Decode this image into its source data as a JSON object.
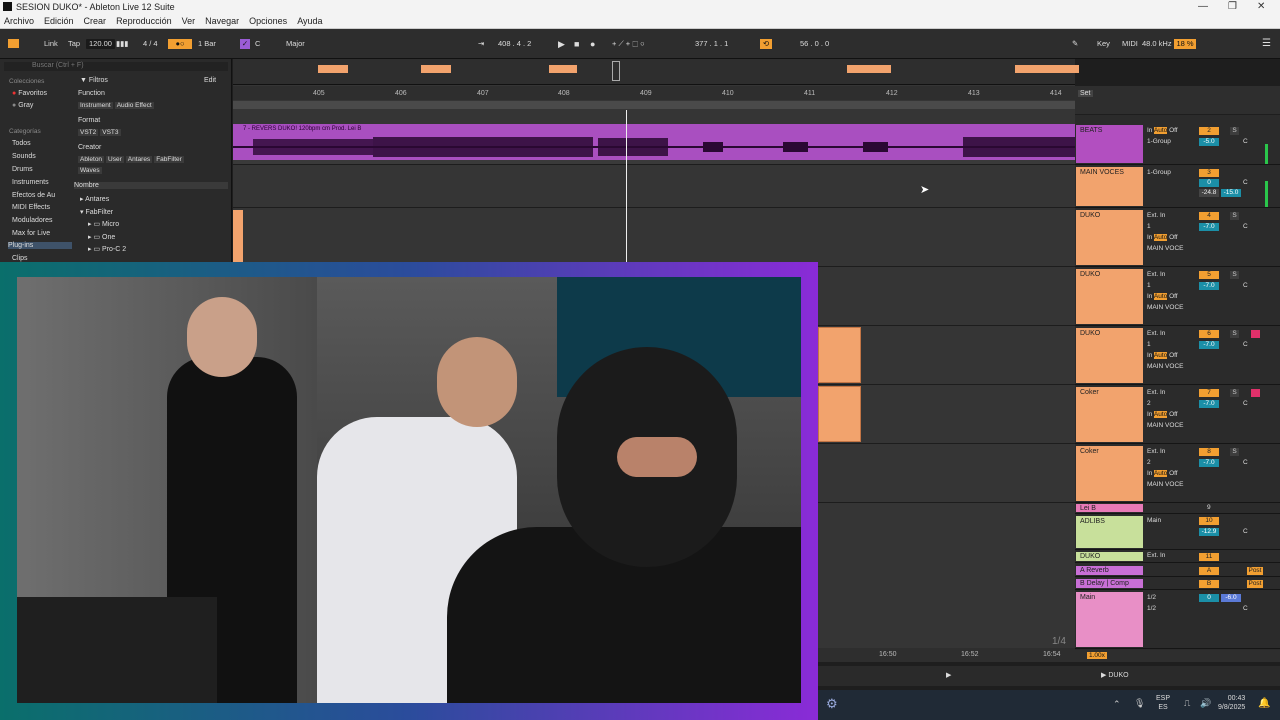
{
  "window": {
    "title": "SESION DUKO* - Ableton Live 12 Suite"
  },
  "menu": [
    "Archivo",
    "Edición",
    "Crear",
    "Reproducción",
    "Ver",
    "Navegar",
    "Opciones",
    "Ayuda"
  ],
  "transport": {
    "link": "Link",
    "tap": "Tap",
    "tempo": "120.00",
    "sig": "4 / 4",
    "quant": "1 Bar",
    "key": "C",
    "scale": "Major",
    "position": "408 . 4 . 2",
    "loop_start": "377 . 1 . 1",
    "loop_len": "56 . 0 . 0",
    "key_label": "Key",
    "midi_label": "MIDI",
    "sample_rate": "48.0 kHz",
    "cpu": "18 %"
  },
  "browser": {
    "search_placeholder": "Buscar (Ctrl + F)",
    "collections_label": "Colecciones",
    "favoritos": "Favoritos",
    "gray": "Gray",
    "categories_label": "Categorías",
    "categories": [
      "Todos",
      "Sounds",
      "Drums",
      "Instruments",
      "Efectos de Au",
      "MIDI Effects",
      "Moduladores",
      "Max for Live",
      "Plug-ins",
      "Clips"
    ],
    "filters_label": "Filtros",
    "edit": "Edit",
    "function": "Function",
    "format": "Format",
    "creator": "Creator",
    "function_tags": [
      "Instrument",
      "Audio Effect"
    ],
    "format_tags": [
      "VST2",
      "VST3"
    ],
    "creator_tags": [
      "Ableton",
      "User",
      "Antares",
      "FabFilter",
      "Waves"
    ],
    "name_header": "Nombre",
    "tree": [
      "Antares",
      "FabFilter",
      "Micro",
      "One",
      "Pro-C 2"
    ]
  },
  "ruler": [
    "405",
    "406",
    "407",
    "408",
    "409",
    "410",
    "411",
    "412",
    "413",
    "414"
  ],
  "clip_label": "7 - REVERS DUKO! 120bpm cm Prod. Lei B",
  "set_label": "Set",
  "fraction": "1/4",
  "times": [
    "16:50",
    "16:52",
    "16:54"
  ],
  "zoom": "1.00x",
  "bottom_track": "DUKO",
  "mixer": {
    "tracks": [
      {
        "name": "BEATS",
        "input": "In Auto Off",
        "route": "1-Group",
        "num": "2",
        "vol": "-5.0",
        "pan": "C",
        "color": "#b24fc0"
      },
      {
        "name": "MAIN VOCES",
        "input": "",
        "route": "1-Group",
        "num": "3",
        "vol": "0",
        "pan": "C",
        "extra": "-24.8",
        "extra2": "-15.0",
        "color": "#f2a36d"
      },
      {
        "name": "DUKO",
        "input": "Ext. In",
        "route": "1",
        "num": "4",
        "vol": "-7.0",
        "pan": "C",
        "out": "MAIN VOCE",
        "color": "#f2a36d"
      },
      {
        "name": "DUKO",
        "input": "Ext. In",
        "route": "1",
        "num": "5",
        "vol": "-7.0",
        "pan": "C",
        "out": "MAIN VOCE",
        "color": "#f2a36d"
      },
      {
        "name": "DUKO",
        "input": "Ext. In",
        "route": "1",
        "num": "6",
        "vol": "-7.0",
        "pan": "C",
        "out": "MAIN VOCE",
        "color": "#f2a36d"
      },
      {
        "name": "Coker",
        "input": "Ext. In",
        "route": "2",
        "num": "7",
        "vol": "-7.0",
        "pan": "C",
        "out": "MAIN VOCE",
        "color": "#f2a36d"
      },
      {
        "name": "Coker",
        "input": "Ext. In",
        "route": "2",
        "num": "8",
        "vol": "-7.0",
        "pan": "C",
        "out": "MAIN VOCE",
        "color": "#f2a36d"
      }
    ],
    "small": [
      {
        "name": "Lei B",
        "num": "9",
        "color": "#e87ab7"
      },
      {
        "name": "ADLIBS",
        "route": "Main",
        "num": "10",
        "vol": "-12.9",
        "pan": "C",
        "color": "#c8e09b"
      },
      {
        "name": "DUKO",
        "route": "Ext. In",
        "num": "11",
        "color": "#c8e09b"
      },
      {
        "name": "A Reverb",
        "num": "A",
        "post": "Post",
        "color": "#c86fd6"
      },
      {
        "name": "B Delay | Comp",
        "num": "B",
        "post": "Post",
        "color": "#c86fd6"
      },
      {
        "name": "Main",
        "route": "1/2",
        "route2": "1/2",
        "num": "0",
        "vol": "-6.0",
        "pan": "C",
        "color": "#e88fc6"
      }
    ],
    "labels": {
      "in": "In",
      "auto": "Auto",
      "off": "Off",
      "inf": "-∞",
      "s": "S"
    }
  },
  "taskbar": {
    "lang": "ESP",
    "lang2": "ES",
    "time": "00:43",
    "date": "9/8/2025"
  }
}
